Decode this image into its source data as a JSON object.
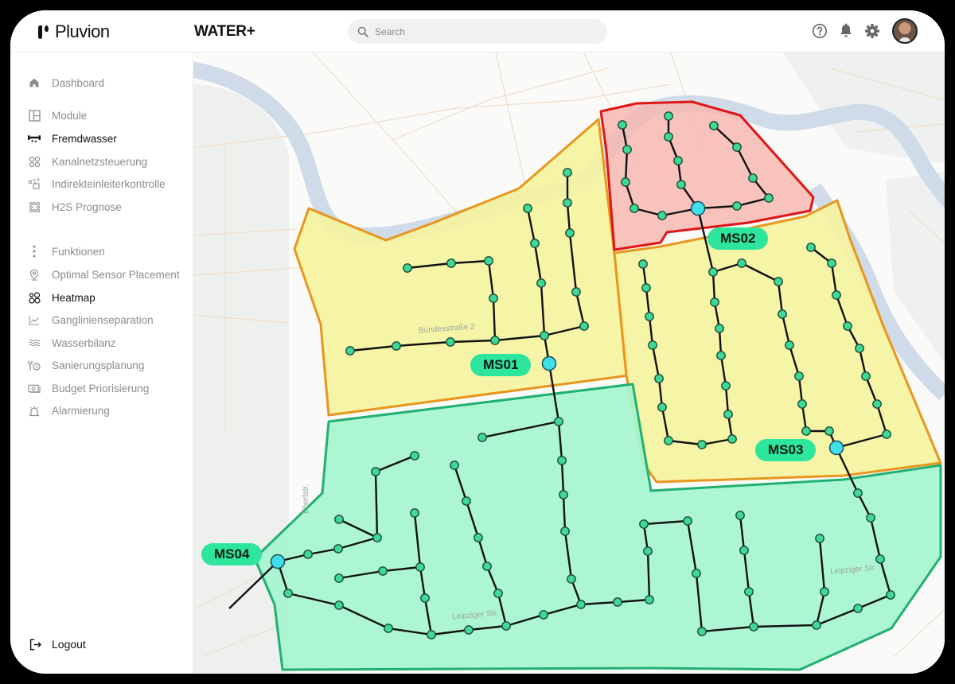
{
  "header": {
    "brand": "Pluvion",
    "app_title": "WATER+",
    "search_placeholder": "Search",
    "search_value": "",
    "icons": [
      "help-circle-icon",
      "bell-icon",
      "gear-icon",
      "user-avatar"
    ]
  },
  "sidebar": {
    "items": [
      {
        "label": "Dashboard",
        "icon": "home-icon",
        "active": false
      },
      {
        "label": "Module",
        "icon": "layout-icon",
        "active": false
      },
      {
        "label": "Fremdwasser",
        "icon": "pipe-icon",
        "active": true
      },
      {
        "label": "Kanalnetzsteuerung",
        "icon": "nodes-icon",
        "active": false
      },
      {
        "label": "Indirekteinleiterkontrolle",
        "icon": "flow-control-icon",
        "active": false
      },
      {
        "label": "H2S Prognose",
        "icon": "dots-grid-icon",
        "active": false
      },
      {
        "label": "Funktionen",
        "icon": "vertical-dots-icon",
        "active": false
      },
      {
        "label": "Optimal Sensor Placement",
        "icon": "location-pin-icon",
        "active": false
      },
      {
        "label": "Heatmap",
        "icon": "circles-icon",
        "active": true
      },
      {
        "label": "Ganglinienseparation",
        "icon": "line-chart-icon",
        "active": false
      },
      {
        "label": "Wasserbilanz",
        "icon": "waves-icon",
        "active": false
      },
      {
        "label": "Sanierungsplanung",
        "icon": "tools-clock-icon",
        "active": false
      },
      {
        "label": "Budget Priorisierung",
        "icon": "money-icon",
        "active": false
      },
      {
        "label": "Alarmierung",
        "icon": "alarm-icon",
        "active": false
      }
    ],
    "logout_label": "Logout"
  },
  "map": {
    "road_labels": [
      "Bundesstraße 2",
      "Leipziger Str.",
      "Leipziger Str.",
      "Ebertstr."
    ],
    "zones": [
      {
        "id": "yellow-west",
        "status": "warning",
        "fill": "#f5f3a0",
        "stroke": "#e8961e"
      },
      {
        "id": "red-north",
        "status": "critical",
        "fill": "#f7b7b3",
        "stroke": "#e01515"
      },
      {
        "id": "yellow-east",
        "status": "warning",
        "fill": "#f5f3a0",
        "stroke": "#e8961e"
      },
      {
        "id": "green-south",
        "status": "ok",
        "fill": "#a6f5d0",
        "stroke": "#22b071"
      }
    ],
    "stations": [
      {
        "label": "MS01"
      },
      {
        "label": "MS02"
      },
      {
        "label": "MS03"
      },
      {
        "label": "MS04"
      }
    ],
    "colors": {
      "station_fill": "#3fe0ee",
      "node_fill": "#3dd996",
      "pipe": "#111111",
      "label_bg": "#2ee59d",
      "river": "#cfdbe8"
    }
  }
}
